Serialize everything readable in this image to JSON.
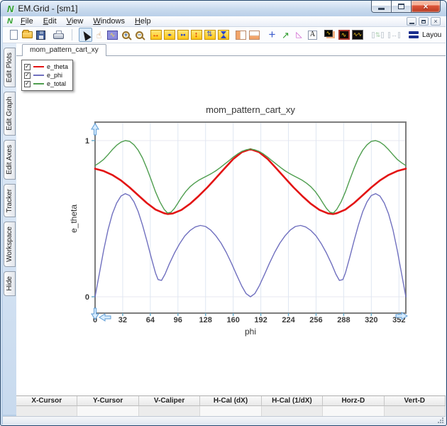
{
  "window": {
    "title": "EM.Grid - [sm1]"
  },
  "menu": {
    "items": [
      "File",
      "Edit",
      "View",
      "Windows",
      "Help"
    ]
  },
  "toolbar": {
    "layout_label": "Layou",
    "icons": [
      {
        "name": "new-document-icon",
        "kind": "page"
      },
      {
        "name": "open-file-icon",
        "kind": "folder"
      },
      {
        "name": "save-icon",
        "kind": "floppy"
      },
      {
        "name": "print-icon",
        "kind": "printer"
      },
      {
        "name": "toolbar-separator",
        "kind": "sep"
      },
      {
        "name": "pointer-tool-icon",
        "kind": "pointer",
        "selected": true
      },
      {
        "name": "pan-hand-icon",
        "kind": "hand"
      },
      {
        "name": "zoom-box-icon",
        "kind": "zoombox"
      },
      {
        "name": "zoom-in-icon",
        "kind": "zoomin"
      },
      {
        "name": "zoom-out-icon",
        "kind": "zoomout"
      },
      {
        "name": "expand-x-icon",
        "kind": "xr"
      },
      {
        "name": "pan-x-icon",
        "kind": "xbo"
      },
      {
        "name": "shrink-x-icon",
        "kind": "xbi"
      },
      {
        "name": "expand-y-icon",
        "kind": "yr"
      },
      {
        "name": "pan-y-icon",
        "kind": "ybo"
      },
      {
        "name": "shrink-y-icon",
        "kind": "ybi"
      },
      {
        "name": "split-columns-icon",
        "kind": "cols"
      },
      {
        "name": "split-rows-icon",
        "kind": "rows"
      },
      {
        "name": "add-marker-icon",
        "kind": "plus"
      },
      {
        "name": "axes-tool-icon",
        "kind": "axes"
      },
      {
        "name": "angle-tool-icon",
        "kind": "angle"
      },
      {
        "name": "text-annotation-icon",
        "kind": "textA"
      },
      {
        "name": "copy-plot-icon",
        "kind": "copyplot"
      },
      {
        "name": "plot-window-icon",
        "kind": "wavesel"
      },
      {
        "name": "multi-plot-icon",
        "kind": "wave2"
      },
      {
        "name": "equalize-vertical-icon",
        "kind": "disv",
        "disabled": true
      },
      {
        "name": "equalize-horizontal-icon",
        "kind": "dish",
        "disabled": true
      },
      {
        "name": "layout-icon",
        "kind": "layoutbars"
      }
    ]
  },
  "sidebar": {
    "tabs": [
      "Edit Plots",
      "Edit Graph",
      "Edit Axes",
      "Tracker",
      "Workspace",
      "Hide"
    ]
  },
  "tab": {
    "label": "mom_pattern_cart_xy"
  },
  "legend": {
    "items": [
      {
        "label": "e_theta",
        "color": "#e31414",
        "checked": true
      },
      {
        "label": "e_phi",
        "color": "#7070bf",
        "checked": true
      },
      {
        "label": "e_total",
        "color": "#4f9e4f",
        "checked": true
      }
    ]
  },
  "chart_data": {
    "type": "line",
    "title": "mom_pattern_cart_xy",
    "xlabel": "phi",
    "ylabel": "e_theta",
    "xlim": [
      0,
      360
    ],
    "ylim": [
      -0.1,
      1.12
    ],
    "x_ticks": [
      0,
      32,
      64,
      96,
      128,
      160,
      192,
      224,
      256,
      288,
      320,
      352
    ],
    "y_ticks": [
      0,
      1
    ],
    "grid": true,
    "legend_position": "top-left",
    "legend_entries": [
      "e_theta",
      "e_phi",
      "e_total"
    ],
    "series": [
      {
        "name": "e_theta",
        "color": "#e31414",
        "width": 2.6,
        "points": [
          [
            0,
            0.82
          ],
          [
            10,
            0.805
          ],
          [
            20,
            0.78
          ],
          [
            30,
            0.745
          ],
          [
            40,
            0.7
          ],
          [
            50,
            0.65
          ],
          [
            60,
            0.6
          ],
          [
            70,
            0.558
          ],
          [
            80,
            0.535
          ],
          [
            84,
            0.53
          ],
          [
            90,
            0.533
          ],
          [
            100,
            0.556
          ],
          [
            110,
            0.595
          ],
          [
            120,
            0.645
          ],
          [
            130,
            0.7
          ],
          [
            140,
            0.76
          ],
          [
            150,
            0.822
          ],
          [
            160,
            0.882
          ],
          [
            170,
            0.926
          ],
          [
            180,
            0.945
          ],
          [
            190,
            0.926
          ],
          [
            200,
            0.882
          ],
          [
            210,
            0.822
          ],
          [
            220,
            0.76
          ],
          [
            230,
            0.7
          ],
          [
            240,
            0.645
          ],
          [
            250,
            0.595
          ],
          [
            260,
            0.556
          ],
          [
            270,
            0.533
          ],
          [
            276,
            0.53
          ],
          [
            280,
            0.535
          ],
          [
            290,
            0.558
          ],
          [
            300,
            0.6
          ],
          [
            310,
            0.65
          ],
          [
            320,
            0.7
          ],
          [
            330,
            0.745
          ],
          [
            340,
            0.78
          ],
          [
            350,
            0.805
          ],
          [
            360,
            0.82
          ]
        ]
      },
      {
        "name": "e_phi",
        "color": "#7070bf",
        "width": 1.4,
        "points": [
          [
            0,
            0
          ],
          [
            5,
            0.15
          ],
          [
            10,
            0.3
          ],
          [
            15,
            0.43
          ],
          [
            20,
            0.53
          ],
          [
            25,
            0.6
          ],
          [
            30,
            0.645
          ],
          [
            35,
            0.66
          ],
          [
            40,
            0.648
          ],
          [
            45,
            0.608
          ],
          [
            50,
            0.545
          ],
          [
            55,
            0.458
          ],
          [
            60,
            0.358
          ],
          [
            65,
            0.252
          ],
          [
            70,
            0.152
          ],
          [
            73,
            0.11
          ],
          [
            77,
            0.105
          ],
          [
            81,
            0.145
          ],
          [
            86,
            0.21
          ],
          [
            92,
            0.28
          ],
          [
            98,
            0.34
          ],
          [
            104,
            0.39
          ],
          [
            110,
            0.424
          ],
          [
            116,
            0.447
          ],
          [
            122,
            0.457
          ],
          [
            128,
            0.45
          ],
          [
            134,
            0.427
          ],
          [
            140,
            0.39
          ],
          [
            146,
            0.343
          ],
          [
            152,
            0.284
          ],
          [
            158,
            0.215
          ],
          [
            164,
            0.14
          ],
          [
            170,
            0.068
          ],
          [
            175,
            0.02
          ],
          [
            180,
            0
          ],
          [
            185,
            0.02
          ],
          [
            190,
            0.068
          ],
          [
            196,
            0.14
          ],
          [
            202,
            0.215
          ],
          [
            208,
            0.284
          ],
          [
            214,
            0.343
          ],
          [
            220,
            0.39
          ],
          [
            226,
            0.427
          ],
          [
            232,
            0.45
          ],
          [
            238,
            0.457
          ],
          [
            244,
            0.447
          ],
          [
            250,
            0.424
          ],
          [
            256,
            0.39
          ],
          [
            262,
            0.34
          ],
          [
            268,
            0.28
          ],
          [
            274,
            0.21
          ],
          [
            279,
            0.145
          ],
          [
            283,
            0.105
          ],
          [
            287,
            0.11
          ],
          [
            290,
            0.152
          ],
          [
            295,
            0.252
          ],
          [
            300,
            0.358
          ],
          [
            305,
            0.458
          ],
          [
            310,
            0.545
          ],
          [
            315,
            0.608
          ],
          [
            320,
            0.648
          ],
          [
            325,
            0.66
          ],
          [
            330,
            0.645
          ],
          [
            335,
            0.6
          ],
          [
            340,
            0.53
          ],
          [
            345,
            0.43
          ],
          [
            350,
            0.3
          ],
          [
            355,
            0.15
          ],
          [
            360,
            0
          ]
        ]
      },
      {
        "name": "e_total",
        "color": "#4f9e4f",
        "width": 1.4,
        "points": [
          [
            0,
            0.84
          ],
          [
            5,
            0.858
          ],
          [
            10,
            0.88
          ],
          [
            15,
            0.91
          ],
          [
            20,
            0.942
          ],
          [
            25,
            0.97
          ],
          [
            30,
            0.99
          ],
          [
            35,
            1.0
          ],
          [
            40,
            0.995
          ],
          [
            45,
            0.973
          ],
          [
            50,
            0.938
          ],
          [
            55,
            0.888
          ],
          [
            60,
            0.822
          ],
          [
            65,
            0.748
          ],
          [
            70,
            0.672
          ],
          [
            75,
            0.608
          ],
          [
            80,
            0.56
          ],
          [
            84,
            0.536
          ],
          [
            88,
            0.542
          ],
          [
            92,
            0.566
          ],
          [
            96,
            0.6
          ],
          [
            100,
            0.636
          ],
          [
            105,
            0.674
          ],
          [
            110,
            0.704
          ],
          [
            115,
            0.727
          ],
          [
            120,
            0.746
          ],
          [
            125,
            0.761
          ],
          [
            130,
            0.775
          ],
          [
            135,
            0.79
          ],
          [
            140,
            0.807
          ],
          [
            145,
            0.827
          ],
          [
            150,
            0.849
          ],
          [
            155,
            0.871
          ],
          [
            160,
            0.894
          ],
          [
            165,
            0.914
          ],
          [
            170,
            0.931
          ],
          [
            175,
            0.941
          ],
          [
            180,
            0.946
          ],
          [
            185,
            0.941
          ],
          [
            190,
            0.931
          ],
          [
            195,
            0.914
          ],
          [
            200,
            0.894
          ],
          [
            205,
            0.871
          ],
          [
            210,
            0.849
          ],
          [
            215,
            0.827
          ],
          [
            220,
            0.807
          ],
          [
            225,
            0.79
          ],
          [
            230,
            0.775
          ],
          [
            235,
            0.761
          ],
          [
            240,
            0.746
          ],
          [
            245,
            0.727
          ],
          [
            250,
            0.704
          ],
          [
            255,
            0.674
          ],
          [
            260,
            0.636
          ],
          [
            264,
            0.6
          ],
          [
            268,
            0.566
          ],
          [
            272,
            0.542
          ],
          [
            276,
            0.536
          ],
          [
            280,
            0.56
          ],
          [
            285,
            0.608
          ],
          [
            290,
            0.672
          ],
          [
            295,
            0.748
          ],
          [
            300,
            0.822
          ],
          [
            305,
            0.888
          ],
          [
            310,
            0.938
          ],
          [
            315,
            0.973
          ],
          [
            320,
            0.995
          ],
          [
            325,
            1.0
          ],
          [
            330,
            0.99
          ],
          [
            335,
            0.97
          ],
          [
            340,
            0.942
          ],
          [
            345,
            0.91
          ],
          [
            350,
            0.88
          ],
          [
            355,
            0.858
          ],
          [
            360,
            0.84
          ]
        ]
      }
    ]
  },
  "status_table": {
    "columns": [
      "X-Cursor",
      "Y-Cursor",
      "V-Caliper",
      "H-Cal (dX)",
      "H-Cal (1/dX)",
      "Horz-D",
      "Vert-D"
    ],
    "values": [
      "",
      "",
      "",
      "",
      "",
      "",
      ""
    ]
  }
}
